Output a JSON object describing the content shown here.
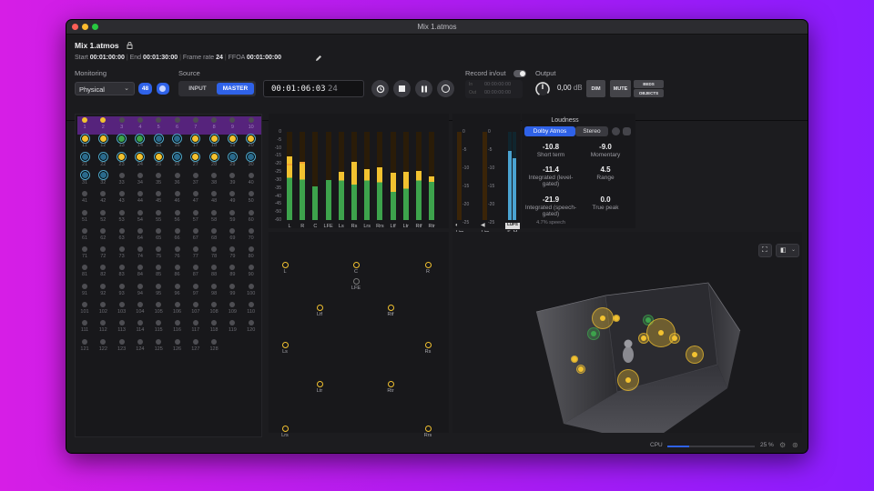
{
  "window": {
    "title": "Mix 1.atmos"
  },
  "header": {
    "name": "Mix 1.atmos",
    "start_label": "Start",
    "start": "00:01:00:00",
    "end_label": "End",
    "end": "00:01:30:00",
    "framerate_label": "Frame rate",
    "framerate": "24",
    "ffoa_label": "FFOA",
    "ffoa": "00:01:00:00",
    "monitoring_label": "Monitoring",
    "monitoring_value": "Physical",
    "monitoring_badge": "48",
    "source_label": "Source",
    "source_input": "INPUT",
    "source_master": "MASTER",
    "timecode": "00:01:06:03",
    "timecode_frames": "24",
    "record_label": "Record in/out",
    "record_in_label": "In",
    "record_in": "00:00:00:00",
    "record_out_label": "Out",
    "record_out": "00:00:00:00",
    "output_label": "Output",
    "output_value": "0,00",
    "output_unit": "dB",
    "dim": "DIM",
    "mute": "MUTE",
    "beds": "BEDS",
    "objects": "OBJECTS"
  },
  "objects_grid": {
    "labels": [
      "1",
      "2",
      "3",
      "4",
      "5",
      "6",
      "7",
      "8",
      "9",
      "10",
      "11",
      "12",
      "13",
      "14",
      "15",
      "16",
      "17",
      "18",
      "19",
      "20",
      "21",
      "22",
      "23",
      "24",
      "25",
      "26",
      "27",
      "28",
      "29",
      "30",
      "31",
      "32",
      "33",
      "34",
      "35",
      "36",
      "37",
      "38",
      "39",
      "40",
      "41",
      "42",
      "43",
      "44",
      "45",
      "46",
      "47",
      "48",
      "49",
      "50",
      "51",
      "52",
      "53",
      "54",
      "55",
      "56",
      "57",
      "58",
      "59",
      "60",
      "61",
      "62",
      "63",
      "64",
      "65",
      "66",
      "67",
      "68",
      "69",
      "70",
      "71",
      "72",
      "73",
      "74",
      "75",
      "76",
      "77",
      "78",
      "79",
      "80",
      "81",
      "82",
      "83",
      "84",
      "85",
      "86",
      "87",
      "88",
      "89",
      "90",
      "91",
      "92",
      "93",
      "94",
      "95",
      "96",
      "97",
      "98",
      "99",
      "100",
      "101",
      "102",
      "103",
      "104",
      "105",
      "106",
      "107",
      "108",
      "109",
      "110",
      "111",
      "112",
      "113",
      "114",
      "115",
      "116",
      "117",
      "118",
      "119",
      "120",
      "121",
      "122",
      "123",
      "124",
      "125",
      "126",
      "127",
      "128"
    ],
    "selected_row_color": "#5a2580",
    "states": [
      "y",
      "y",
      "g",
      "g",
      "g",
      "g",
      "g",
      "g",
      "g",
      "g",
      "YR",
      "YR",
      "GR",
      "GR",
      "BR",
      "BR",
      "YR",
      "YR",
      "YR",
      "YR",
      "BR",
      "BR",
      "YR",
      "YR",
      "YR",
      "BR",
      "YR",
      "YR",
      "BR",
      "BR",
      "BR",
      "BR",
      "g",
      "g",
      "g",
      "g",
      "g",
      "g",
      "g",
      "g"
    ]
  },
  "meters": {
    "bed_channels": [
      {
        "label": "L",
        "level": 0.72,
        "peak": 0.62,
        "green": 0.48
      },
      {
        "label": "R",
        "level": 0.66,
        "peak": 0.64,
        "green": 0.46
      },
      {
        "label": "C",
        "level": 0.38,
        "peak": 0.48,
        "green": 0.38
      },
      {
        "label": "LFE",
        "level": 0.45,
        "peak": 0.5,
        "green": 0.45
      },
      {
        "label": "Ls",
        "level": 0.55,
        "peak": 0.58,
        "green": 0.45
      },
      {
        "label": "Rs",
        "level": 0.66,
        "peak": 0.8,
        "green": 0.4
      },
      {
        "label": "Lrs",
        "level": 0.58,
        "peak": 0.66,
        "green": 0.45
      },
      {
        "label": "Rrs",
        "level": 0.6,
        "peak": 0.7,
        "green": 0.43
      },
      {
        "label": "Ltf",
        "level": 0.54,
        "peak": 0.57,
        "green": 0.32
      },
      {
        "label": "Ltr",
        "level": 0.55,
        "peak": 0.58,
        "green": 0.36
      },
      {
        "label": "Rtf",
        "level": 0.56,
        "peak": 0.6,
        "green": 0.45
      },
      {
        "label": "Rtr",
        "level": 0.5,
        "peak": 0.55,
        "green": 0.44
      }
    ],
    "scale": [
      "0",
      "-5",
      "-10",
      "-15",
      "-20",
      "-25",
      "-30",
      "-35",
      "-40",
      "-45",
      "-50",
      "-60"
    ],
    "scale_b": [
      "0",
      "-5",
      "-10",
      "-15",
      "-20",
      "-25"
    ],
    "lim_labels": [
      "Lim",
      "Lim"
    ],
    "loudness_meter_labels": [
      "LUFS",
      "S",
      "M"
    ]
  },
  "loudness": {
    "title": "Loudness",
    "tab_active": "Dolby Atmos",
    "tab_other": "Stereo",
    "short_term": "-10.8",
    "short_term_label": "Short term",
    "momentary": "-9.0",
    "momentary_label": "Momentary",
    "integrated": "-11.4",
    "integrated_label": "Integrated (level-gated)",
    "range": "4.5",
    "range_label": "Range",
    "integrated_speech": "-21.9",
    "integrated_speech_label": "Integrated (speech-gated)",
    "speech_pct": "4.7% speech",
    "true_peak": "0.0",
    "true_peak_label": "True peak"
  },
  "speakers": [
    "L",
    "C",
    "R",
    "LFE",
    "Ltf",
    "Rtf",
    "Ls",
    "Rs",
    "Ltr",
    "Rtr",
    "Lrs",
    "Rrs"
  ],
  "footer": {
    "cpu_label": "CPU",
    "cpu_value": "25 %",
    "cpu_fraction": 0.25
  },
  "colors": {
    "yellow": "#f2c230",
    "green": "#3da34c",
    "blue": "#2f6bf0",
    "teal": "#4fa7c9",
    "purple_row": "#56237c"
  }
}
